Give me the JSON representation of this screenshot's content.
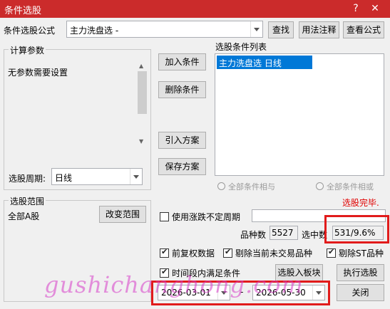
{
  "window": {
    "title": "条件选股"
  },
  "formula": {
    "label": "条件选股公式",
    "value": "主力洗盘选  -"
  },
  "buttons": {
    "find": "查找",
    "usage": "用法注释",
    "view_formula": "查看公式",
    "add_condition": "加入条件",
    "delete_condition": "删除条件",
    "import_plan": "引入方案",
    "save_plan": "保存方案",
    "change_range": "改变范围",
    "to_block": "选股入板块",
    "execute": "执行选股",
    "close": "关闭"
  },
  "params": {
    "legend": "计算参数",
    "no_params": "无参数需要设置",
    "period_label": "选股周期:",
    "period_value": "日线"
  },
  "condition_list": {
    "label": "选股条件列表",
    "items": [
      "主力洗盘选  日线"
    ]
  },
  "logic": {
    "and_label": "全部条件相与",
    "or_label": "全部条件相或"
  },
  "status": {
    "text": "选股完毕."
  },
  "range": {
    "legend": "选股范围",
    "value": "全部A股"
  },
  "options": {
    "variable_period": "使用涨跌不定周期",
    "prev_adjust": "前复权数据",
    "remove_untraded": "剔除当前未交易品种",
    "remove_st": "剔除ST品种",
    "time_range": "时间段内满足条件"
  },
  "stats": {
    "count_label": "品种数",
    "count_value": "5527",
    "selected_label": "选中数",
    "selected_value": "531/9.6%"
  },
  "dates": {
    "start": "2026-03-01",
    "separator": "-",
    "end": "2026-05-30"
  },
  "watermark": "gushichanghong.com",
  "colors": {
    "titlebar": "#cb2b2b",
    "selection": "#0078d7",
    "status": "#e00000",
    "highlight": "#e11b1b"
  }
}
